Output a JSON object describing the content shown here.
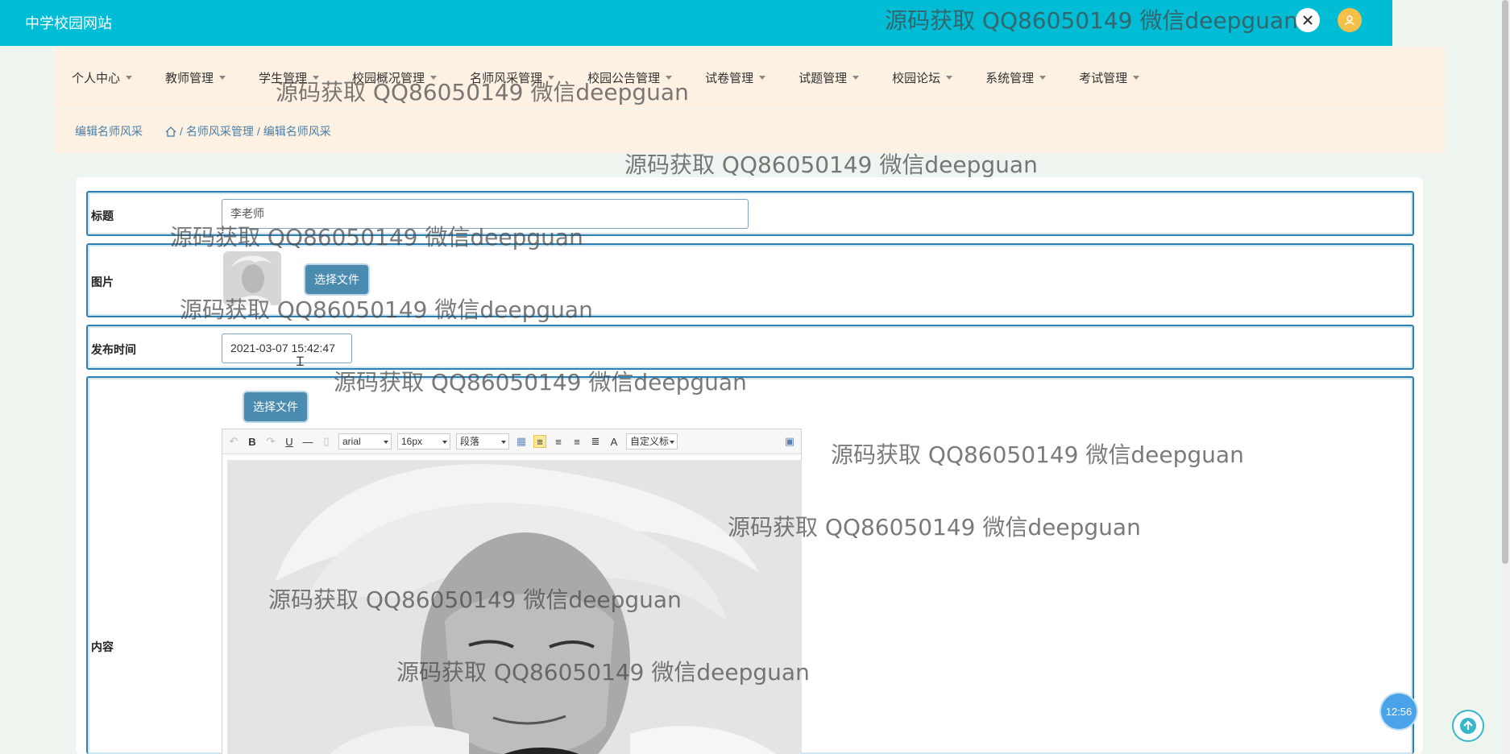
{
  "header": {
    "brand": "中学校园网站",
    "close_icon": "close-icon",
    "avatar_icon": "user-icon"
  },
  "nav": {
    "items": [
      "个人中心",
      "教师管理",
      "学生管理",
      "校园概况管理",
      "名师风采管理",
      "校园公告管理",
      "试卷管理",
      "试题管理",
      "校园论坛",
      "系统管理",
      "考试管理"
    ]
  },
  "breadcrumb": {
    "title": "编辑名师风采",
    "path": [
      "名师风采管理",
      "编辑名师风采"
    ],
    "separator": "/"
  },
  "form": {
    "title_label": "标题",
    "title_value": "李老师",
    "image_label": "图片",
    "image_button": "选择文件",
    "time_label": "发布时间",
    "time_value": "2021-03-07 15:42:47",
    "content_label": "内容",
    "content_button": "选择文件"
  },
  "editor": {
    "font_family": "arial",
    "font_size": "16px",
    "paragraph": "段落",
    "custom_style": "自定义标"
  },
  "watermark": "源码获取 QQ86050149 微信deepguan",
  "time_badge": "12:56",
  "colors": {
    "topbar": "#00bcd4",
    "nav_bg": "#fdf1e3",
    "button": "#4b8bb0",
    "row_border": "#2f7fb0"
  }
}
